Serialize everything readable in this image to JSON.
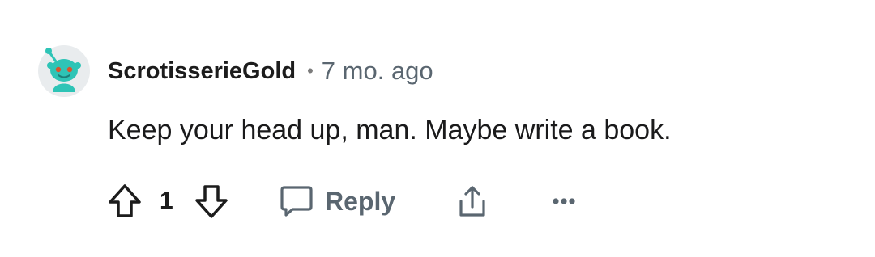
{
  "comment": {
    "username": "ScrotisserieGold",
    "separator": "•",
    "age": "7 mo. ago",
    "text": "Keep your head up, man. Maybe write a book."
  },
  "actions": {
    "vote_count": "1",
    "reply_label": "Reply",
    "more_label": "•••"
  },
  "icons": {
    "avatar": "snoo-avatar-icon",
    "upvote": "upvote-arrow-icon",
    "downvote": "downvote-arrow-icon",
    "reply": "speech-bubble-icon",
    "share": "share-icon",
    "more": "more-options-icon"
  },
  "colors": {
    "avatar_accent": "#2ec4b6",
    "text_primary": "#1c1c1c",
    "text_secondary": "#5a6670"
  }
}
